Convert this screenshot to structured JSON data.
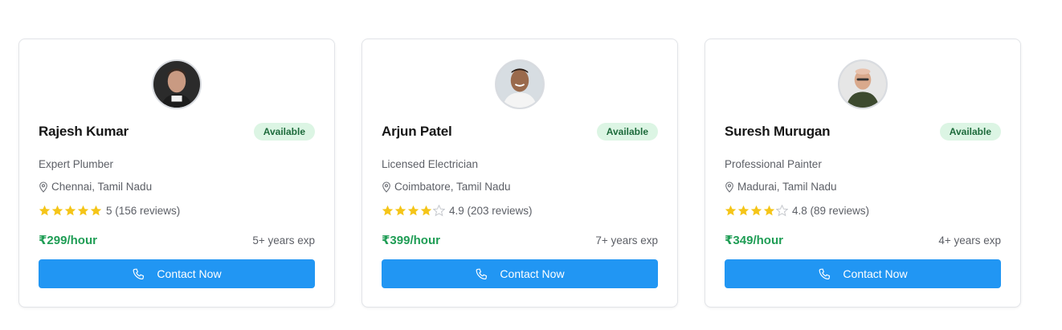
{
  "colors": {
    "primary_button": "#2196f3",
    "price": "#1f9d55",
    "badge_bg": "#dcf5e4",
    "badge_text": "#1e6b3c",
    "star_filled": "#f5c518",
    "star_empty": "#c4c7cc"
  },
  "cards": [
    {
      "name": "Rajesh Kumar",
      "status": "Available",
      "profession": "Expert Plumber",
      "location": "Chennai, Tamil Nadu",
      "rating": 5,
      "rating_text": "5 (156 reviews)",
      "price": "₹299/hour",
      "experience": "5+ years exp",
      "button_label": "Contact Now",
      "avatar_icon": "user-avatar-photo"
    },
    {
      "name": "Arjun Patel",
      "status": "Available",
      "profession": "Licensed Electrician",
      "location": "Coimbatore, Tamil Nadu",
      "rating": 4,
      "rating_text": "4.9 (203 reviews)",
      "price": "₹399/hour",
      "experience": "7+ years exp",
      "button_label": "Contact Now",
      "avatar_icon": "user-avatar-photo"
    },
    {
      "name": "Suresh Murugan",
      "status": "Available",
      "profession": "Professional Painter",
      "location": "Madurai, Tamil Nadu",
      "rating": 4,
      "rating_text": "4.8 (89 reviews)",
      "price": "₹349/hour",
      "experience": "4+ years exp",
      "button_label": "Contact Now",
      "avatar_icon": "user-avatar-photo"
    }
  ],
  "icons": {
    "location": "map-pin-icon",
    "star": "star-icon",
    "phone": "phone-icon"
  }
}
